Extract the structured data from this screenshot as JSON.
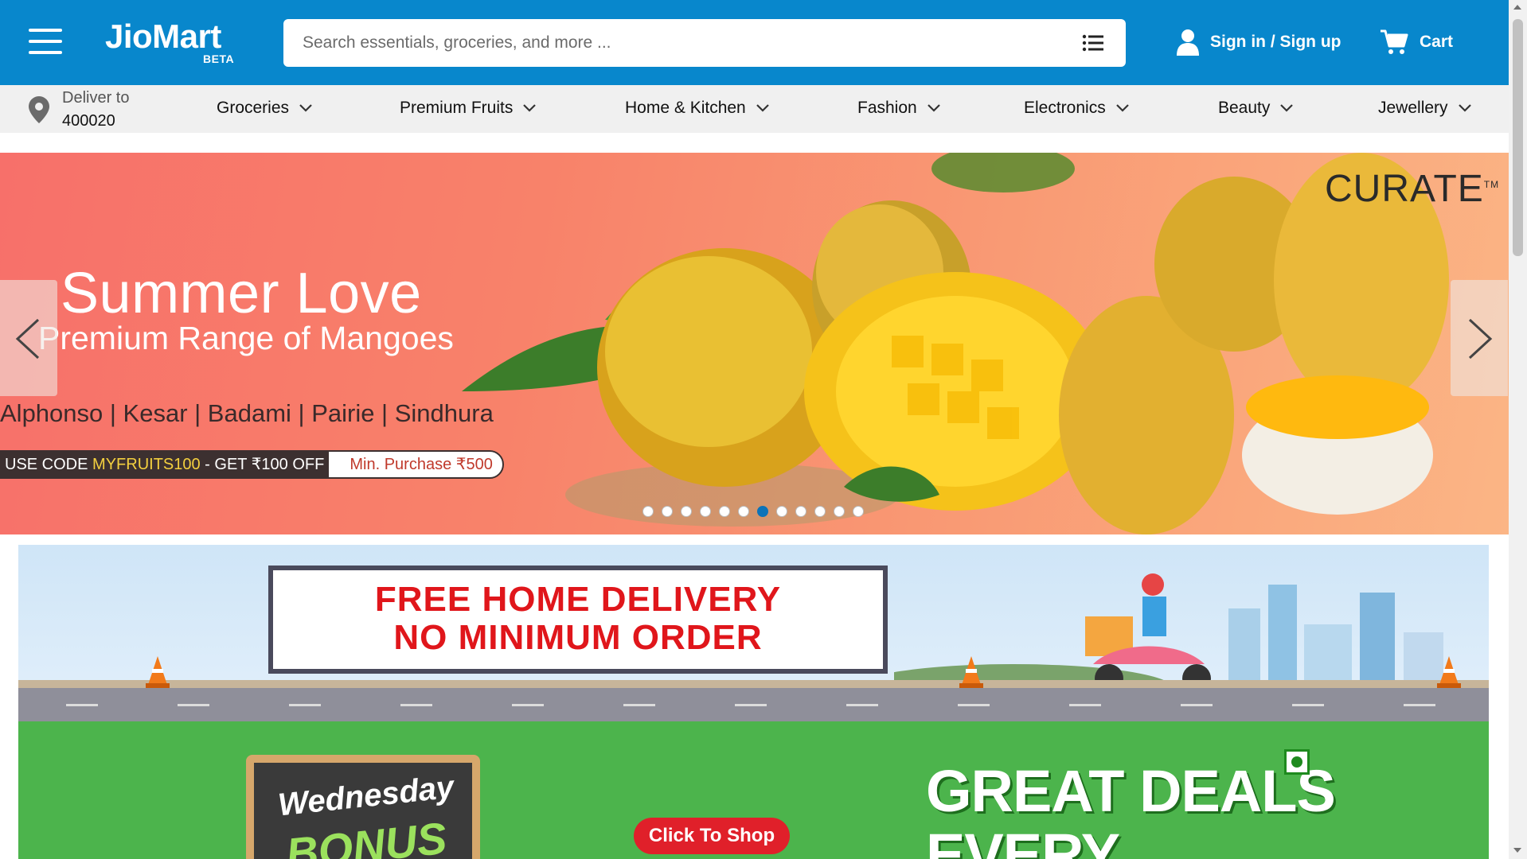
{
  "header": {
    "logo": "JioMart",
    "logo_badge": "BETA",
    "search_placeholder": "Search essentials, groceries, and more ...",
    "signin_label": "Sign in / Sign up",
    "cart_label": "Cart",
    "brand_color": "#0887cc"
  },
  "delivery": {
    "label": "Deliver to",
    "pincode": "400020"
  },
  "categories": [
    {
      "label": "Groceries"
    },
    {
      "label": "Premium Fruits"
    },
    {
      "label": "Home & Kitchen"
    },
    {
      "label": "Fashion"
    },
    {
      "label": "Electronics"
    },
    {
      "label": "Beauty"
    },
    {
      "label": "Jewellery"
    }
  ],
  "hero": {
    "brand": "CURATE",
    "brand_tm": "TM",
    "title": "Summer Love",
    "subtitle": "Premium Range of Mangoes",
    "varieties": "Alphonso | Kesar | Badami | Pairie | Sindhura",
    "coupon_prefix": "USE CODE ",
    "coupon_code": "MYFRUITS100",
    "coupon_suffix": " - GET ₹100 OFF",
    "min_purchase": "Min. Purchase ₹500",
    "slide_count": 12,
    "active_slide": 7
  },
  "delivery_banner": {
    "line1": "FREE HOME DELIVERY",
    "line2": "NO MINIMUM ORDER"
  },
  "deals_banner": {
    "board_line1": "Wednesday",
    "board_line2": "BONUS",
    "cta": "Click To Shop",
    "title_line1": "GREAT DEALS",
    "title_line2": "EVERY"
  }
}
